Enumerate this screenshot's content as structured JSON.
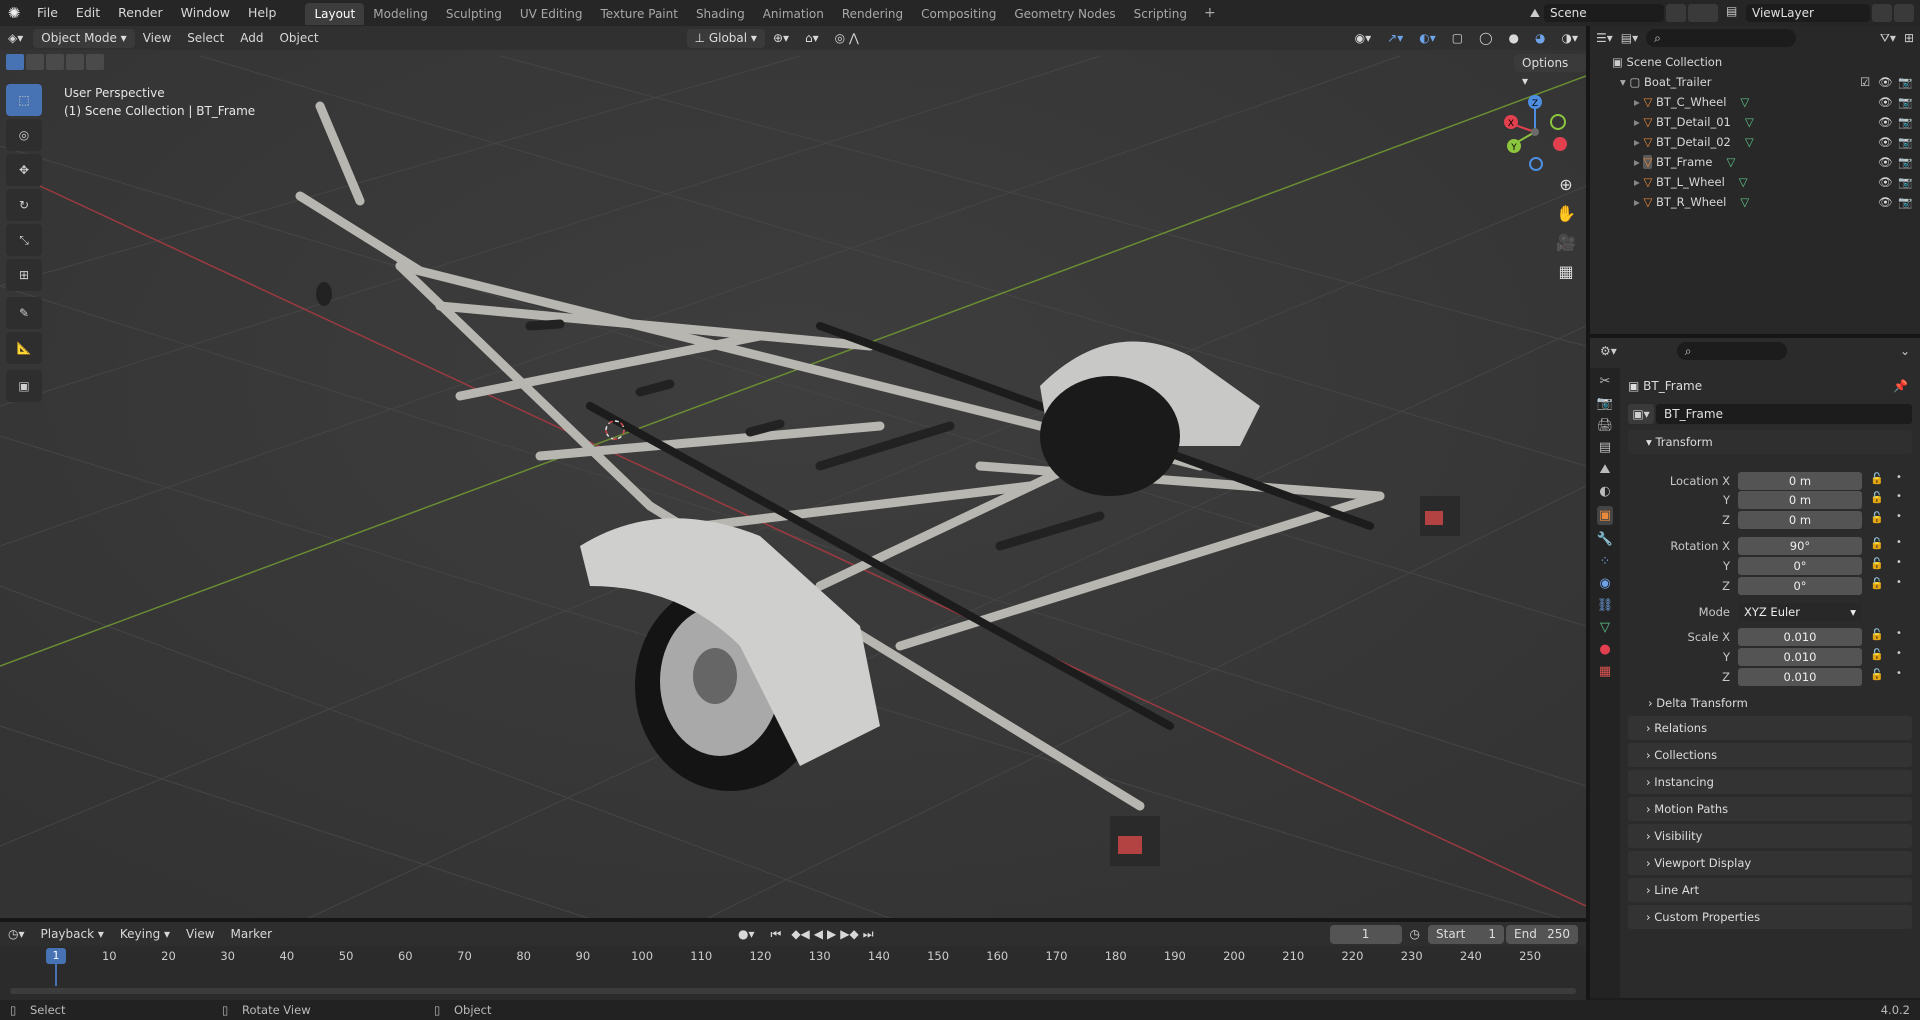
{
  "app": {
    "version": "4.0.2"
  },
  "menu": [
    "File",
    "Edit",
    "Render",
    "Window",
    "Help"
  ],
  "workspaces": [
    "Layout",
    "Modeling",
    "Sculpting",
    "UV Editing",
    "Texture Paint",
    "Shading",
    "Animation",
    "Rendering",
    "Compositing",
    "Geometry Nodes",
    "Scripting"
  ],
  "active_workspace": "Layout",
  "scene": "Scene",
  "view_layer": "ViewLayer",
  "viewport": {
    "mode": "Object Mode",
    "menus": [
      "View",
      "Select",
      "Add",
      "Object"
    ],
    "transform_orientation": "Global",
    "options_label": "Options",
    "overlay_title": "User Perspective",
    "overlay_subtitle": "(1) Scene Collection | BT_Frame",
    "gizmo": {
      "x": "X",
      "y": "Y",
      "z": "Z"
    }
  },
  "outliner": {
    "root": "Scene Collection",
    "collection": "Boat_Trailer",
    "objects": [
      "BT_C_Wheel",
      "BT_Detail_01",
      "BT_Detail_02",
      "BT_Frame",
      "BT_L_Wheel",
      "BT_R_Wheel"
    ],
    "selected": "BT_Frame"
  },
  "properties": {
    "object_name": "BT_Frame",
    "datablock": "BT_Frame",
    "transform_label": "Transform",
    "location": {
      "label_x": "Location X",
      "label_y": "Y",
      "label_z": "Z",
      "x": "0 m",
      "y": "0 m",
      "z": "0 m"
    },
    "rotation": {
      "label_x": "Rotation X",
      "label_y": "Y",
      "label_z": "Z",
      "x": "90°",
      "y": "0°",
      "z": "0°"
    },
    "mode_label": "Mode",
    "mode": "XYZ Euler",
    "scale": {
      "label_x": "Scale X",
      "label_y": "Y",
      "label_z": "Z",
      "x": "0.010",
      "y": "0.010",
      "z": "0.010"
    },
    "delta": "Delta Transform",
    "panels": [
      "Relations",
      "Collections",
      "Instancing",
      "Motion Paths",
      "Visibility",
      "Viewport Display",
      "Line Art",
      "Custom Properties"
    ]
  },
  "timeline": {
    "menus": [
      "Playback",
      "Keying",
      "View",
      "Marker"
    ],
    "current_frame": "1",
    "start_label": "Start",
    "start": "1",
    "end_label": "End",
    "end": "250",
    "ticks": [
      "10",
      "20",
      "30",
      "40",
      "50",
      "60",
      "70",
      "80",
      "90",
      "100",
      "110",
      "120",
      "130",
      "140",
      "150",
      "160",
      "170",
      "180",
      "190",
      "200",
      "210",
      "220",
      "230",
      "240",
      "250"
    ],
    "playhead": "1"
  },
  "status": {
    "select": "Select",
    "rotate": "Rotate View",
    "object": "Object"
  },
  "colors": {
    "accent": "#4772b3",
    "x_axis": "#e3404f",
    "y_axis": "#8cc63f",
    "z_axis": "#4d8ee0",
    "object_orange": "#e8893c",
    "data_green": "#5fc88a"
  }
}
